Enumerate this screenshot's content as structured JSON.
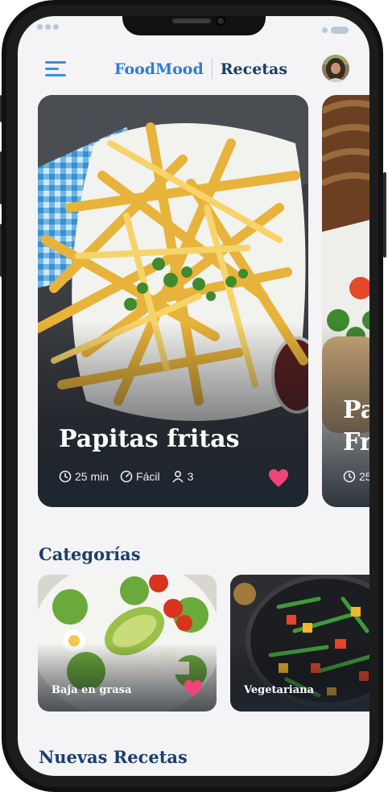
{
  "header": {
    "brand_primary": "FoodMood",
    "brand_secondary": "Recetas"
  },
  "featured": [
    {
      "title": "Papitas fritas",
      "time": "25 min",
      "difficulty": "Fácil",
      "servings": "3",
      "favorite": true
    },
    {
      "title": "Pa\nFr",
      "time": "25"
    }
  ],
  "sections": {
    "categories_title": "Categorías",
    "new_recipes_title": "Nuevas Recetas"
  },
  "categories": [
    {
      "label": "Baja en grasa",
      "favorite": true
    },
    {
      "label": "Vegetariana"
    }
  ],
  "colors": {
    "accent": "#2d7fd3",
    "heading": "#1a3f6a",
    "favorite": "#f0447a",
    "background": "#f4f4f6"
  },
  "icons": [
    "menu-icon",
    "clock-icon",
    "gauge-icon",
    "user-icon",
    "heart-icon"
  ]
}
